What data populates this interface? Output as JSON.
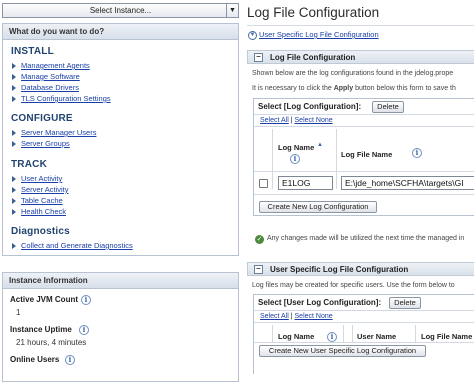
{
  "sidebar": {
    "instance_select": "Select Instance...",
    "nav_header": "What do you want to do?",
    "sections": [
      {
        "title": "INSTALL",
        "items": [
          "Management Agents",
          "Manage Software",
          "Database Drivers",
          "TLS Configuration Settings"
        ]
      },
      {
        "title": "CONFIGURE",
        "items": [
          "Server Manager Users",
          "Server Groups"
        ]
      },
      {
        "title": "TRACK",
        "items": [
          "User Activity",
          "Server Activity",
          "Table Cache",
          "Health Check"
        ]
      },
      {
        "title": "Diagnostics",
        "items": [
          "Collect and Generate Diagnostics"
        ]
      }
    ],
    "info_header": "Instance Information",
    "info": [
      {
        "label": "Active JVM Count",
        "value": "1"
      },
      {
        "label": "Instance Uptime",
        "value": "21 hours, 4 minutes"
      },
      {
        "label": "Online Users",
        "value": ""
      }
    ]
  },
  "main": {
    "title": "Log File Configuration",
    "jump_link": "User Specific Log File Configuration",
    "log_section": {
      "title": "Log File Configuration",
      "desc1": "Shown below are the log configurations found in the jdelog.prope",
      "desc2_pre": "It is necessary to click the ",
      "desc2_bold": "Apply",
      "desc2_post": " button below this form to save th",
      "toolbar_label": "Select [Log Configuration]:",
      "delete_label": "Delete",
      "select_all": "Select All",
      "select_none": "Select None",
      "col_log_name": "Log Name",
      "col_log_file_name": "Log File Name",
      "row_log_name": "E1LOG",
      "row_log_file": "E:\\jde_home\\SCFHA\\targets\\GI",
      "create_button": "Create New Log Configuration",
      "note": "Any changes made will be utilized the next time the managed in"
    },
    "user_section": {
      "title": "User Specific Log File Configuration",
      "desc": "Log files may be created for specific users. Use the form below to",
      "toolbar_label": "Select [User Log Configuration]:",
      "delete_label": "Delete",
      "select_all": "Select All",
      "select_none": "Select None",
      "col_log_name": "Log Name",
      "col_user_name": "User Name",
      "col_log_file_name": "Log File Name",
      "create_button": "Create New User Specific Log Configuration"
    }
  },
  "colors": {
    "section_heading": "#21446f",
    "link": "#1a3fa8",
    "header_bg": "#d7dfea"
  }
}
